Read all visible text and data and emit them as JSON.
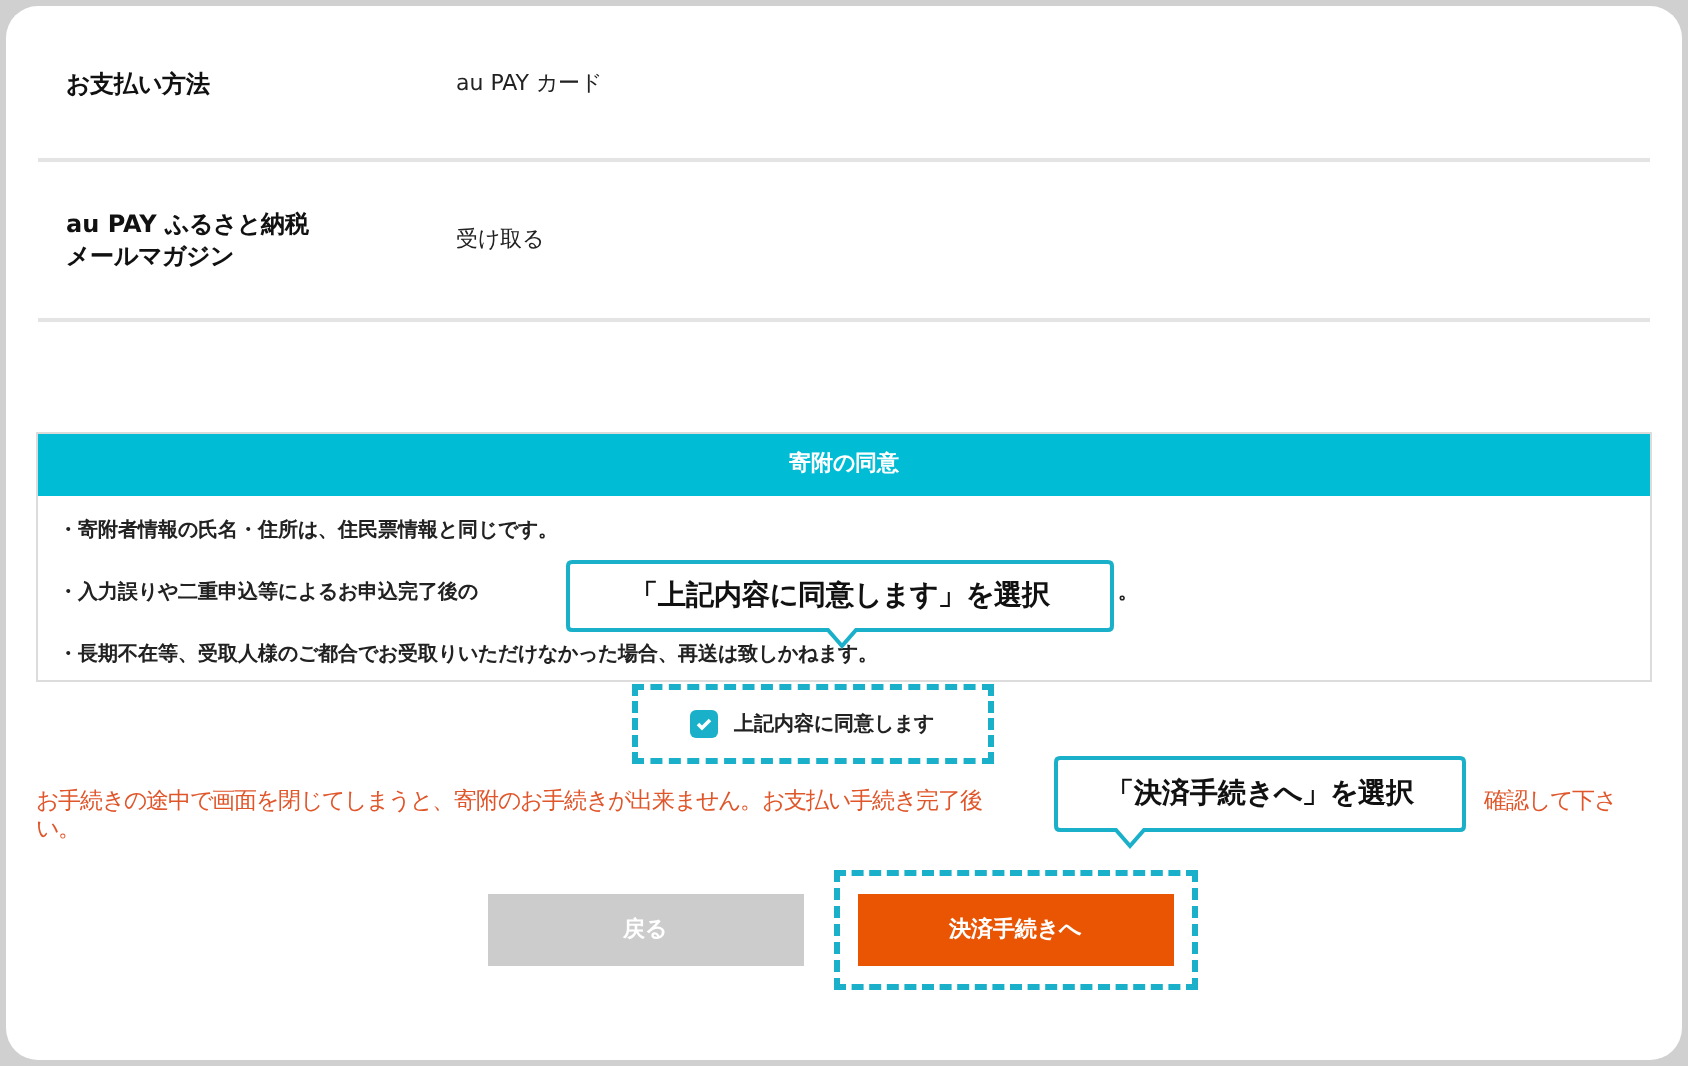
{
  "details": [
    {
      "label": "お支払い方法",
      "value": "au PAY カード"
    },
    {
      "label": [
        "au PAY ふるさと納税",
        "メールマガジン"
      ],
      "value": "受け取る"
    }
  ],
  "consent": {
    "title": "寄附の同意",
    "lines": [
      [
        "・寄附者情報の氏名・住所は、住民票情報と同じです。"
      ],
      [
        "・入力誤りや二重申込等によるお申込完了後の",
        "。"
      ],
      [
        "・長期不在等、受取人様のご都合でお受取りいただけなかった場合、再送は致しかねます。"
      ]
    ]
  },
  "agree": {
    "label": "上記内容に同意します",
    "checked": true
  },
  "warning": {
    "line_1": [
      "お手続きの途中で画面を閉じてしまうと、寄附のお手続きが出来ません。お支払い手続き完了後",
      "確認して下さ"
    ],
    "line_2": "い。"
  },
  "buttons": [
    {
      "label": "戻る",
      "disabled": true
    },
    {
      "label": "決済手続きへ",
      "disabled": false
    }
  ],
  "callouts": [
    "「上記内容に同意します」を選択",
    "「決済手続きへ」を選択"
  ]
}
